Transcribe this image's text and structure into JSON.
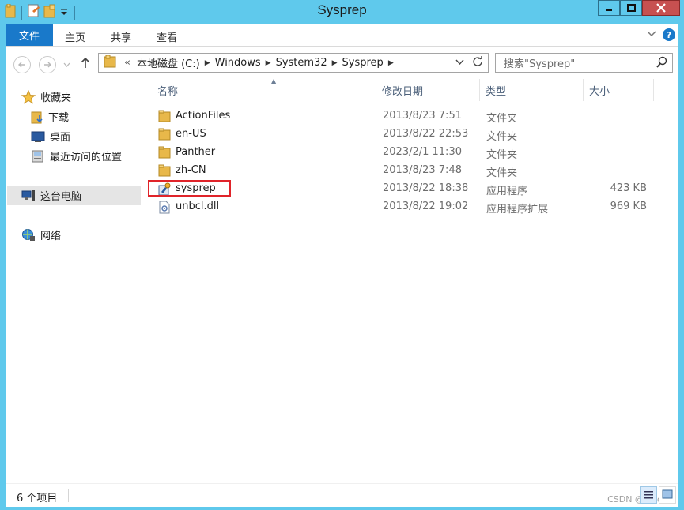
{
  "window": {
    "title": "Sysprep"
  },
  "ribbon": {
    "tabs": [
      "文件",
      "主页",
      "共享",
      "查看"
    ]
  },
  "address": {
    "prefix": "«",
    "crumbs": [
      "本地磁盘 (C:)",
      "Windows",
      "System32",
      "Sysprep"
    ]
  },
  "search": {
    "placeholder": "搜索\"Sysprep\""
  },
  "nav": {
    "favorites": "收藏夹",
    "downloads": "下载",
    "desktop": "桌面",
    "recent": "最近访问的位置",
    "this_pc": "这台电脑",
    "network": "网络"
  },
  "columns": {
    "name": "名称",
    "date": "修改日期",
    "type": "类型",
    "size": "大小"
  },
  "files": [
    {
      "name": "ActionFiles",
      "date": "2013/8/23 7:51",
      "type": "文件夹",
      "size": "",
      "icon": "folder-icon"
    },
    {
      "name": "en-US",
      "date": "2013/8/22 22:53",
      "type": "文件夹",
      "size": "",
      "icon": "folder-icon"
    },
    {
      "name": "Panther",
      "date": "2023/2/1 11:30",
      "type": "文件夹",
      "size": "",
      "icon": "folder-icon"
    },
    {
      "name": "zh-CN",
      "date": "2013/8/23 7:48",
      "type": "文件夹",
      "size": "",
      "icon": "folder-icon"
    },
    {
      "name": "sysprep",
      "date": "2013/8/22 18:38",
      "type": "应用程序",
      "size": "423 KB",
      "icon": "application-icon"
    },
    {
      "name": "unbcl.dll",
      "date": "2013/8/22 19:02",
      "type": "应用程序扩展",
      "size": "969 KB",
      "icon": "dll-icon"
    }
  ],
  "status": {
    "count": "6 个项目"
  },
  "watermark": "CSDN @Sir.ch"
}
